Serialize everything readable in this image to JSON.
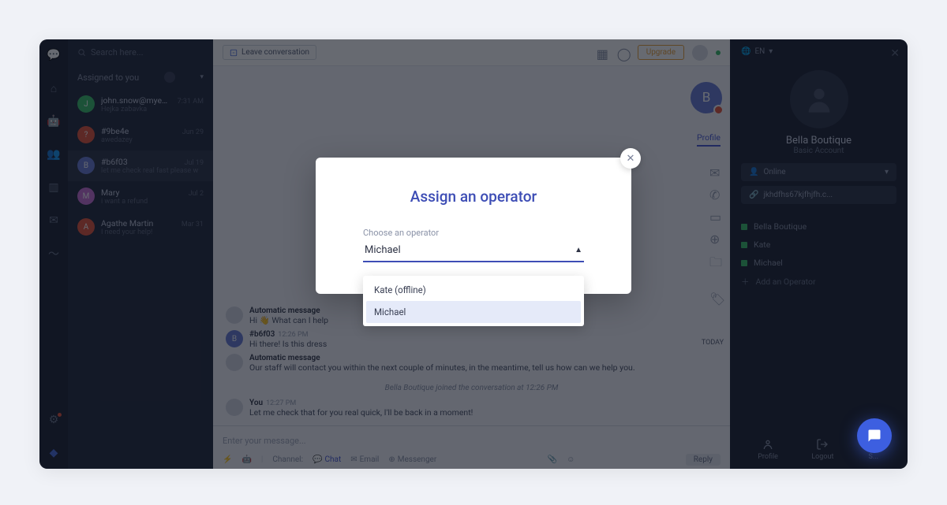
{
  "search_placeholder": "Search here...",
  "section_header": "Assigned to you",
  "conversations": [
    {
      "name": "john.snow@myema...",
      "time": "7:31 AM",
      "preview": "Hejka zabavka",
      "avColor": "#3bbf6a",
      "initial": "J"
    },
    {
      "name": "#9be4e",
      "time": "Jun 29",
      "preview": "awedazey",
      "avColor": "#e5553c",
      "initial": "?"
    },
    {
      "name": "#b6f03",
      "time": "Jul 19",
      "preview": "let me check real fast please w",
      "avColor": "#6b7dd6",
      "initial": "B"
    },
    {
      "name": "Mary",
      "time": "Jul 2",
      "preview": "i want a refund",
      "avColor": "#c770d6",
      "initial": "M"
    },
    {
      "name": "Agathe Martin",
      "time": "Mar 31",
      "preview": "I need your help!",
      "avColor": "#e5553c",
      "initial": "A"
    }
  ],
  "leave_label": "Leave conversation",
  "upgrade_label": "Upgrade",
  "chat_avatar_letter": "B",
  "profile_tab": "Profile",
  "today_label": "TODAY",
  "messages": [
    {
      "from": "Automatic message",
      "ts": "",
      "txt": "Hi 👋 What can I help",
      "av": ""
    },
    {
      "from": "#b6f03",
      "ts": "12:26 PM",
      "txt": "Hi there! Is this dress",
      "av": "B"
    },
    {
      "from": "Automatic message",
      "ts": "",
      "txt": "Our staff will contact you within the next couple of minutes, in the meantime, tell us how can we help you.",
      "av": ""
    }
  ],
  "sys_msg": "Bella Boutique joined the conversation at 12:26 PM",
  "messages2": [
    {
      "from": "You",
      "ts": "12:27 PM",
      "txt": "Let me check that for you real quick, I'll be back in a moment!",
      "av": ""
    }
  ],
  "composer_placeholder": "Enter your message...",
  "channels": {
    "label": "Channel:",
    "chat": "Chat",
    "email": "Email",
    "messenger": "Messenger"
  },
  "reply_label": "Reply",
  "rside": {
    "lang": "EN",
    "title": "Bella Boutique",
    "sub": "Basic Account",
    "status": "Online",
    "url": "jkhdfhs67kjfhjfh.c...",
    "ops": [
      {
        "name": "Bella Boutique",
        "color": "#3bbf6a"
      },
      {
        "name": "Kate",
        "color": "#3bbf6a"
      },
      {
        "name": "Michael",
        "color": "#3bbf6a"
      }
    ],
    "add": "Add an Operator",
    "footer": {
      "profile": "Profile",
      "logout": "Logout",
      "s": "S..."
    }
  },
  "modal": {
    "title": "Assign an operator",
    "label": "Choose an operator",
    "value": "Michael",
    "options": [
      {
        "label": "Kate (offline)",
        "selected": false
      },
      {
        "label": "Michael",
        "selected": true
      }
    ]
  }
}
